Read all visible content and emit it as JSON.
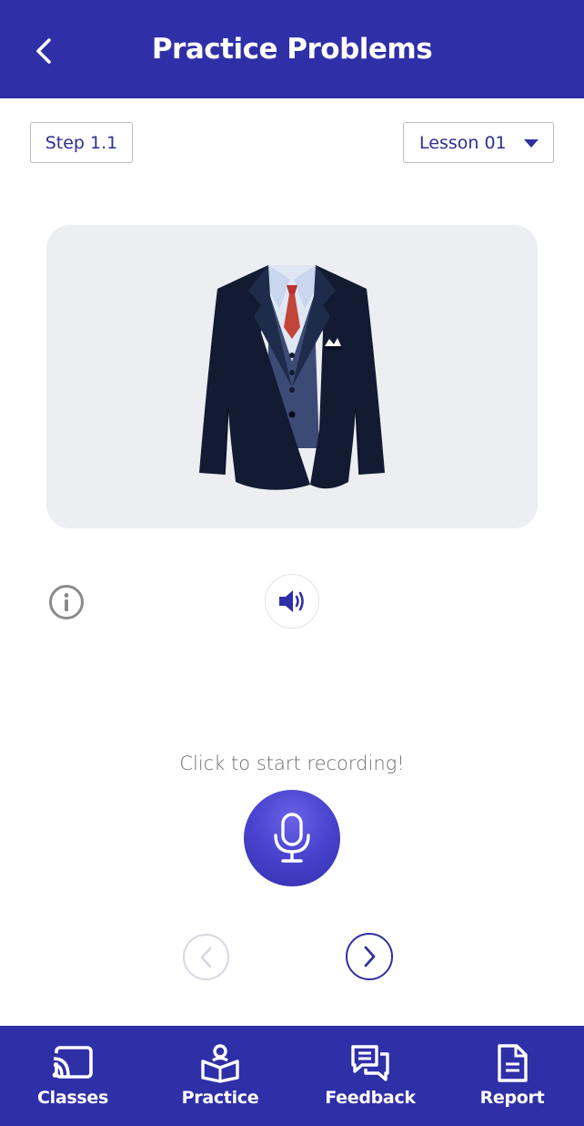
{
  "header": {
    "title": "Practice Problems",
    "back_icon": "chevron-left-icon"
  },
  "controls": {
    "step_label": "Step 1.1",
    "lesson_selected": "Lesson 01"
  },
  "card": {
    "image_subject": "suit-jacket-illustration"
  },
  "actions": {
    "info_icon": "info-icon",
    "sound_icon": "speaker-icon",
    "record_hint": "Click to start recording!",
    "mic_icon": "microphone-icon",
    "prev_icon": "chevron-left-icon",
    "next_icon": "chevron-right-icon"
  },
  "bottom_nav": {
    "items": [
      {
        "label": "Classes",
        "icon": "cast-icon"
      },
      {
        "label": "Practice",
        "icon": "reader-icon"
      },
      {
        "label": "Feedback",
        "icon": "chat-bubbles-icon"
      },
      {
        "label": "Report",
        "icon": "document-icon"
      }
    ]
  },
  "colors": {
    "primary": "#2f2fa8",
    "card_bg": "#eceef2",
    "text_muted": "#6e6e72"
  }
}
